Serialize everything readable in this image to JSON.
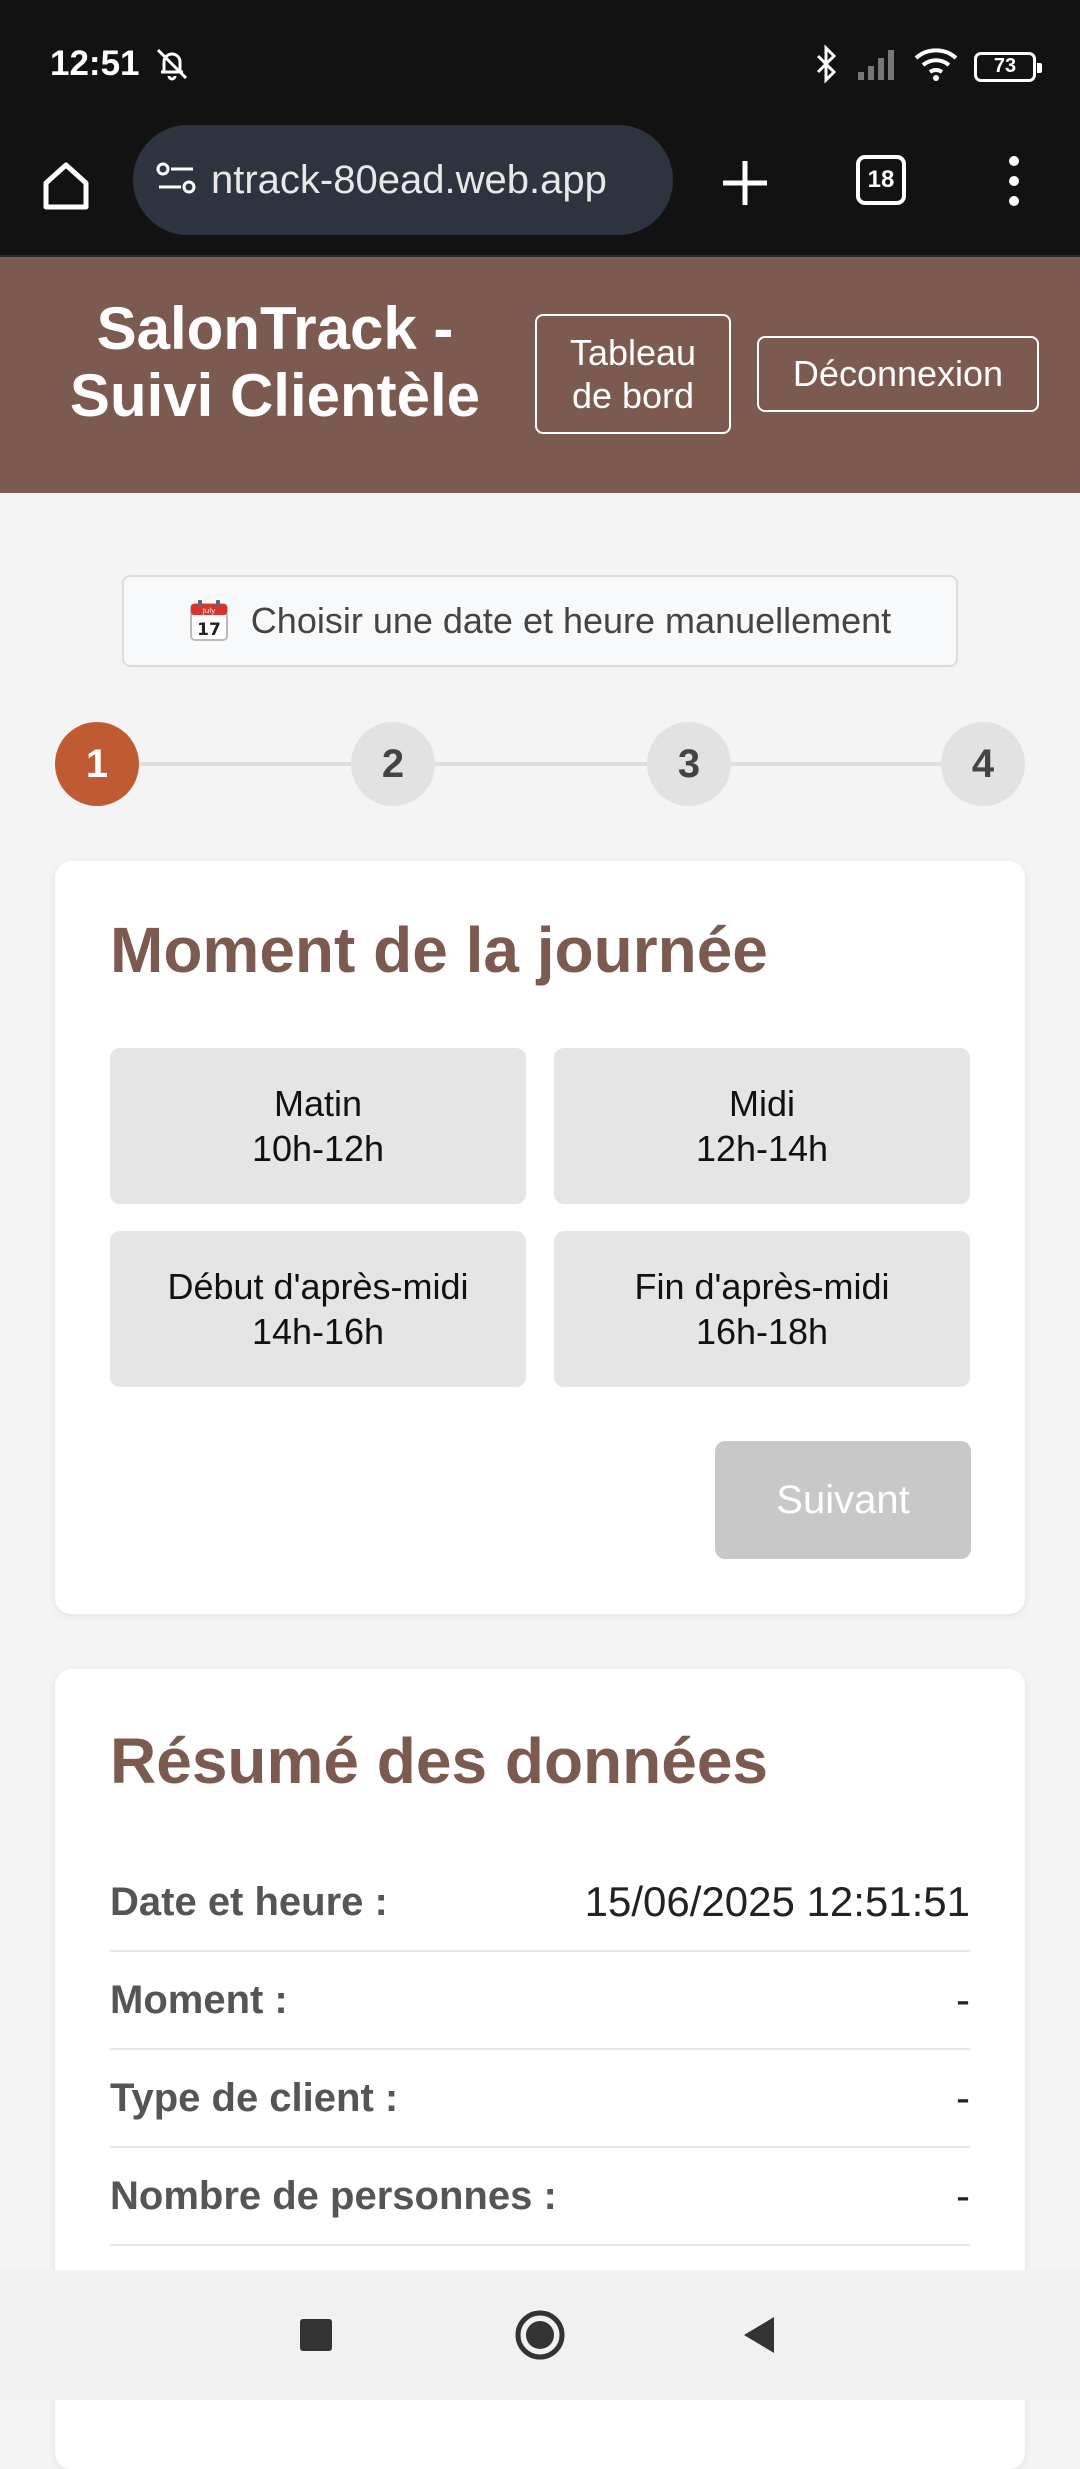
{
  "status_bar": {
    "time": "12:51",
    "battery": "73",
    "icons": [
      "bell-off-icon",
      "bluetooth-icon",
      "signal-icon",
      "wifi-icon",
      "battery-icon"
    ]
  },
  "browser": {
    "url": "ntrack-80ead.web.app",
    "tab_count": "18",
    "icons": [
      "home-icon",
      "site-settings-icon",
      "plus-icon",
      "tabs-icon",
      "more-vert-icon"
    ]
  },
  "header": {
    "title_line1": "SalonTrack -",
    "title_line2": "Suivi Clientèle",
    "dashboard_line1": "Tableau",
    "dashboard_line2": "de bord",
    "logout": "Déconnexion",
    "bg_color": "#7d5a4f"
  },
  "manual": {
    "label": "Choisir une date et heure manuellement",
    "calendar_icon_text": "17",
    "calendar_icon_month": "July"
  },
  "stepper": {
    "steps": [
      "1",
      "2",
      "3",
      "4"
    ],
    "active_step": 1,
    "active_color": "#c05a33"
  },
  "moment_card": {
    "title": "Moment de la journée",
    "slots": [
      {
        "name": "Matin",
        "hours": "10h-12h"
      },
      {
        "name": "Midi",
        "hours": "12h-14h"
      },
      {
        "name": "Début d'après-midi",
        "hours": "14h-16h"
      },
      {
        "name": "Fin d'après-midi",
        "hours": "16h-18h"
      }
    ],
    "next_label": "Suivant"
  },
  "summary_card": {
    "title": "Résumé des données",
    "rows": [
      {
        "label": "Date et heure :",
        "value": "15/06/2025 12:51:51"
      },
      {
        "label": "Moment :",
        "value": "-"
      },
      {
        "label": "Type de client :",
        "value": "-"
      },
      {
        "label": "Nombre de personnes :",
        "value": "-"
      }
    ]
  },
  "nav_bar": {
    "icons": [
      "recents-icon",
      "home-icon",
      "back-icon"
    ]
  }
}
